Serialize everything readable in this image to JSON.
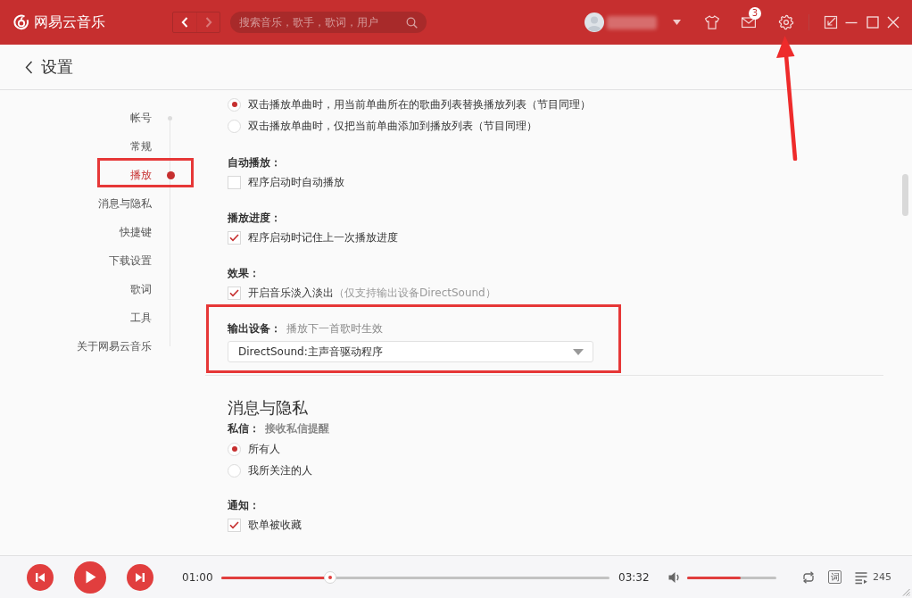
{
  "app": {
    "name": "网易云音乐"
  },
  "toolbar": {
    "history": {
      "back": {
        "disabled": false
      },
      "forward": {
        "disabled": true
      }
    },
    "search": {
      "placeholder": "搜索音乐，歌手，歌词，用户"
    },
    "mail_badge": "3"
  },
  "header": {
    "title": "设置"
  },
  "nav": [
    {
      "label": "帐号",
      "selected": false
    },
    {
      "label": "常规",
      "selected": false
    },
    {
      "label": "播放",
      "selected": true
    },
    {
      "label": "消息与隐私",
      "selected": false
    },
    {
      "label": "快捷键",
      "selected": false
    },
    {
      "label": "下载设置",
      "selected": false
    },
    {
      "label": "歌词",
      "selected": false
    },
    {
      "label": "工具",
      "selected": false
    },
    {
      "label": "关于网易云音乐",
      "selected": false
    }
  ],
  "sections": [
    {
      "groups": [
        {
          "kind": "radio",
          "options": [
            {
              "label": "双击播放单曲时，用当前单曲所在的歌曲列表替换播放列表（节目同理）",
              "selected": true
            },
            {
              "label": "双击播放单曲时，仅把当前单曲添加到播放列表（节目同理）",
              "selected": false
            }
          ]
        },
        {
          "kind": "checkbox",
          "title": "自动播放：",
          "options": [
            {
              "label": "程序启动时自动播放",
              "checked": false
            }
          ]
        },
        {
          "kind": "checkbox",
          "title": "播放进度：",
          "options": [
            {
              "label": "程序启动时记住上一次播放进度",
              "checked": true
            }
          ]
        },
        {
          "kind": "checkbox",
          "title": "效果：",
          "options": [
            {
              "label": "开启音乐淡入淡出",
              "note": "（仅支持输出设备DirectSound）",
              "checked": true
            }
          ]
        },
        {
          "kind": "select",
          "title": "输出设备：",
          "hint": "播放下一首歌时生效",
          "value": "DirectSound:主声音驱动程序"
        }
      ]
    },
    {
      "heading": "消息与隐私",
      "groups": [
        {
          "kind": "radio",
          "title": "私信：",
          "subtitle": "接收私信提醒",
          "options": [
            {
              "label": "所有人",
              "selected": true
            },
            {
              "label": "我所关注的人",
              "selected": false
            }
          ]
        },
        {
          "kind": "checkbox",
          "title": "通知：",
          "options": [
            {
              "label": "歌单被收藏",
              "checked": true
            }
          ]
        }
      ]
    }
  ],
  "player": {
    "elapsed": "01:00",
    "duration": "03:32",
    "progress": {
      "level": 0.28
    },
    "volume": {
      "level": 0.6
    },
    "lyrics_button": "词",
    "playlist_count": "245"
  }
}
